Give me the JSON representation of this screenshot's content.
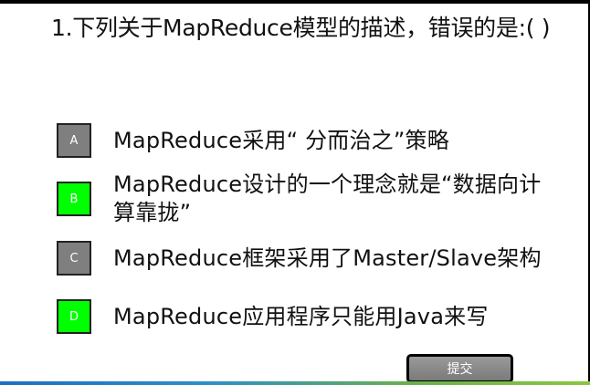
{
  "question": {
    "text": "1.下列关于MapReduce模型的描述，错误的是:( )"
  },
  "options": [
    {
      "letter": "A",
      "text": "MapReduce采用“ 分而治之”策略",
      "state": "unselected",
      "color": "#7f7f7f"
    },
    {
      "letter": "B",
      "text": "MapReduce设计的一个理念就是“数据向计算靠拢”",
      "state": "selected",
      "color": "#00ff00"
    },
    {
      "letter": "C",
      "text": "MapReduce框架采用了Master/Slave架构",
      "state": "unselected",
      "color": "#7f7f7f"
    },
    {
      "letter": "D",
      "text": "MapReduce应用程序只能用Java来写",
      "state": "selected",
      "color": "#00ff00"
    }
  ],
  "submit": {
    "label": "提交"
  }
}
